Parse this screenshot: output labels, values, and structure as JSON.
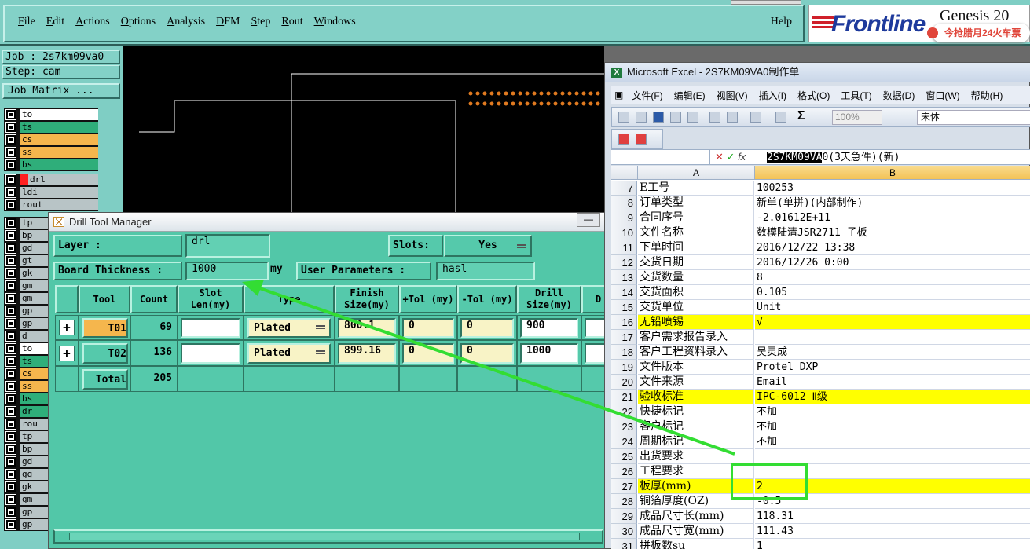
{
  "menu": {
    "items": [
      "File",
      "Edit",
      "Actions",
      "Options",
      "Analysis",
      "DFM",
      "Step",
      "Rout",
      "Windows"
    ],
    "help": "Help"
  },
  "logo": {
    "brand": "Frontline",
    "product": "Genesis 20"
  },
  "promo": {
    "text": "今抢腊月24火车票"
  },
  "left_panel": {
    "job": "Job : 2s7km09va0",
    "step": "Step: cam",
    "job_matrix": "Job Matrix ...",
    "layers_group1": [
      "to",
      "ts",
      "cs",
      "ss",
      "bs"
    ],
    "layers_group2": [
      "drl",
      "ldi",
      "rout"
    ],
    "layers_group3": [
      "tp",
      "bp",
      "gd",
      "gt",
      "gk",
      "gm",
      "gm",
      "gp",
      "gp",
      "d",
      "to",
      "ts",
      "cs",
      "ss",
      "bs",
      "dr",
      "rou",
      "tp",
      "bp",
      "gd",
      "gg",
      "gk",
      "gm",
      "gp",
      "gp"
    ]
  },
  "drill_tool_manager": {
    "title": "Drill Tool Manager",
    "minimize": "—",
    "layer_label": "Layer          :",
    "layer_value": "drl",
    "slots_label": "Slots:",
    "slots_value": "Yes",
    "board_thickness_label": "Board Thickness :",
    "board_thickness_value": "1000",
    "board_thickness_unit": "my",
    "user_params_label": "User Parameters :",
    "user_params_value": "hasl",
    "columns": [
      "Tool",
      "Count",
      "Slot Len(my)",
      "Type",
      "Finish Size(my)",
      "+Tol (my)",
      "-Tol (my)",
      "Drill Size(my)",
      "D"
    ],
    "rows": [
      {
        "tool": "T01",
        "count": "69",
        "slot_len": "",
        "type": "Plated",
        "finish": "800.1",
        "plus_tol": "0",
        "minus_tol": "0",
        "drill": "900"
      },
      {
        "tool": "T02",
        "count": "136",
        "slot_len": "",
        "type": "Plated",
        "finish": "899.16",
        "plus_tol": "0",
        "minus_tol": "0",
        "drill": "1000"
      }
    ],
    "total_label": "Total",
    "total_count": "205"
  },
  "excel": {
    "title": "Microsoft Excel - 2S7KM09VA0制作单",
    "menu": [
      "文件(F)",
      "编辑(E)",
      "视图(V)",
      "插入(I)",
      "格式(O)",
      "工具(T)",
      "数据(D)",
      "窗口(W)",
      "帮助(H)"
    ],
    "zoom": "100%",
    "font": "宋体",
    "formula_selected": "2S7KM09VA",
    "formula_rest": "0(3天急件)(新)",
    "col_a": "A",
    "col_b": "B",
    "rows": [
      {
        "n": "7",
        "a": "E工号",
        "b": "100253",
        "hl": false
      },
      {
        "n": "8",
        "a": "订单类型",
        "b": "新单(单拼)(内部制作)",
        "hl": false
      },
      {
        "n": "9",
        "a": "合同序号",
        "b": "-2.01612E+11",
        "hl": false
      },
      {
        "n": "10",
        "a": "文件名称",
        "b": "数模陆清JSR2711 子板",
        "hl": false
      },
      {
        "n": "11",
        "a": "下单时间",
        "b": "2016/12/22 13:38",
        "hl": false
      },
      {
        "n": "12",
        "a": "交货日期",
        "b": "2016/12/26 0:00",
        "hl": false
      },
      {
        "n": "13",
        "a": "交货数量",
        "b": "8",
        "hl": false
      },
      {
        "n": "14",
        "a": "交货面积",
        "b": "0.105",
        "hl": false
      },
      {
        "n": "15",
        "a": "交货单位",
        "b": "Unit",
        "hl": false
      },
      {
        "n": "16",
        "a": "无铅喷锡",
        "b": "√",
        "hl": true
      },
      {
        "n": "17",
        "a": "客户需求报告录入",
        "b": "",
        "hl": false
      },
      {
        "n": "18",
        "a": "客户工程资料录入",
        "b": "吴灵成",
        "hl": false
      },
      {
        "n": "19",
        "a": "文件版本",
        "b": "Protel DXP",
        "hl": false
      },
      {
        "n": "20",
        "a": "文件来源",
        "b": "Email",
        "hl": false
      },
      {
        "n": "21",
        "a": "验收标准",
        "b": "IPC-6012 Ⅱ级",
        "hl": true
      },
      {
        "n": "22",
        "a": "快捷标记",
        "b": "不加",
        "hl": false
      },
      {
        "n": "23",
        "a": "客户标记",
        "b": "不加",
        "hl": false
      },
      {
        "n": "24",
        "a": "周期标记",
        "b": "不加",
        "hl": false
      },
      {
        "n": "25",
        "a": "出货要求",
        "b": "",
        "hl": false
      },
      {
        "n": "26",
        "a": "工程要求",
        "b": "",
        "hl": false
      },
      {
        "n": "27",
        "a": "板厚(mm)",
        "b": "2",
        "hl": true
      },
      {
        "n": "28",
        "a": "铜箔厚度(OZ)",
        "b": "-0.5",
        "hl": false
      },
      {
        "n": "29",
        "a": "成品尺寸长(mm)",
        "b": "118.31",
        "hl": false
      },
      {
        "n": "30",
        "a": "成品尺寸宽(mm)",
        "b": "111.43",
        "hl": false
      },
      {
        "n": "31",
        "a": "拼板数su",
        "b": "1",
        "hl": false
      }
    ]
  },
  "colors": {
    "panel": "#7fcec4",
    "drill_bg": "#52c7a8",
    "highlight": "#ffff00",
    "annotation": "#33dd33"
  }
}
